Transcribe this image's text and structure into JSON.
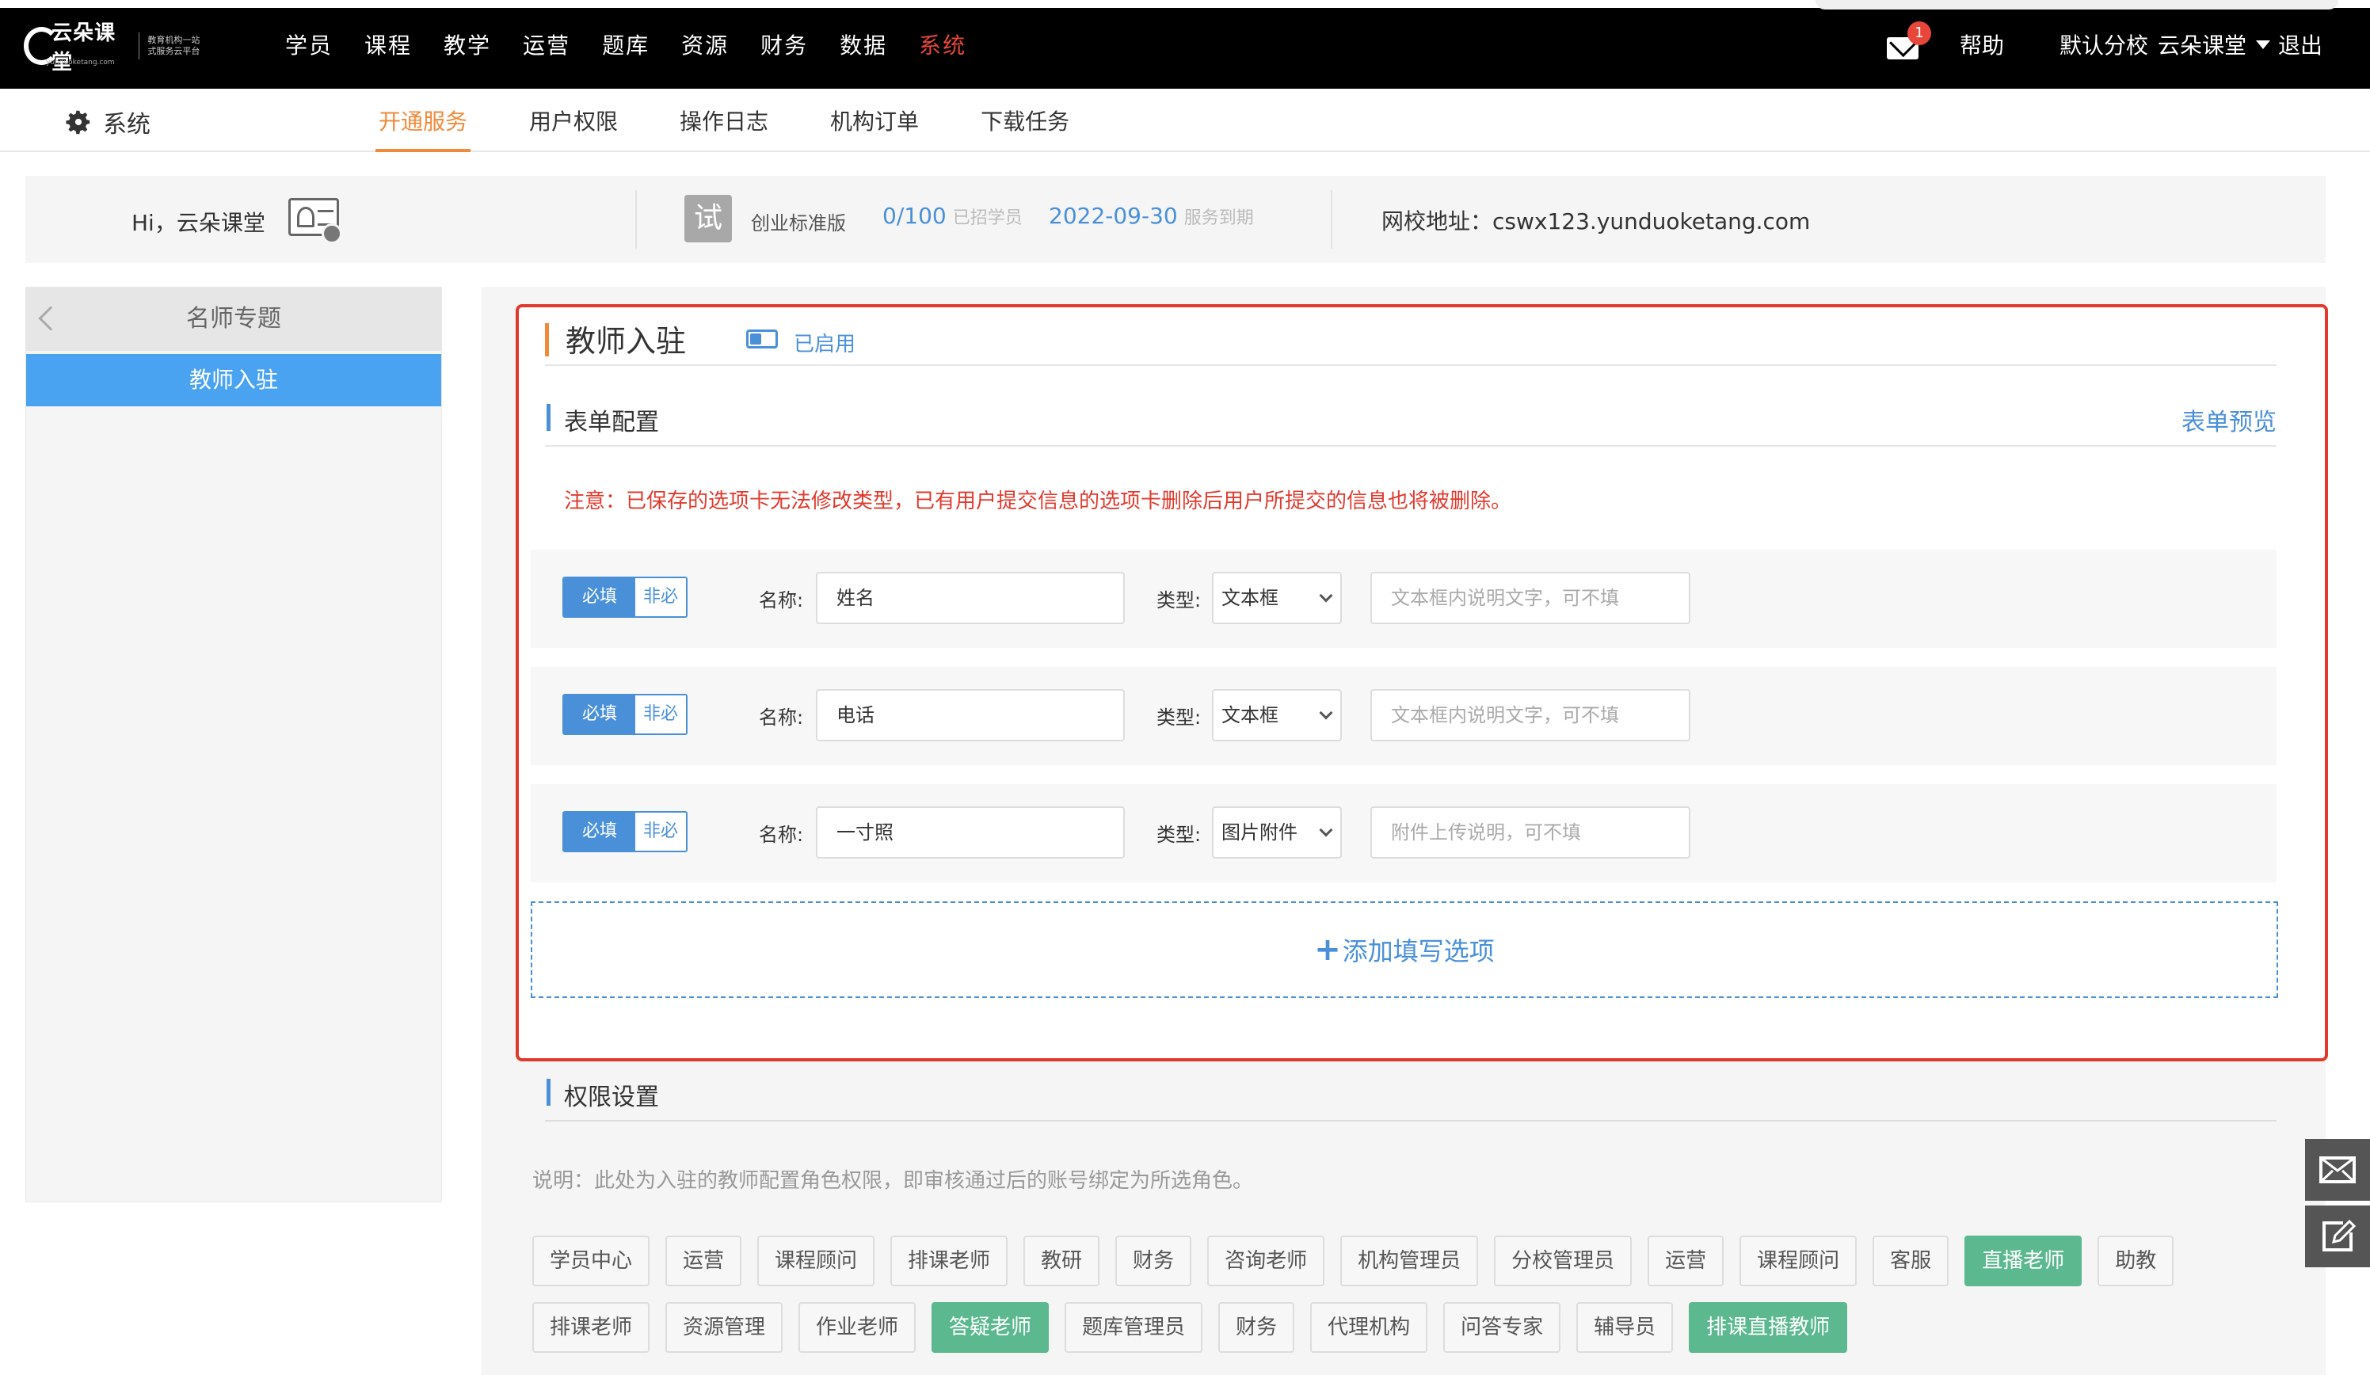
{
  "topbar": {
    "logo": {
      "name": "云朵课堂",
      "slogan": "教育机构一站式服务云平台",
      "domain": "yunduoketang.com"
    },
    "nav": [
      "学员",
      "课程",
      "教学",
      "运营",
      "题库",
      "资源",
      "财务",
      "数据",
      "系统"
    ],
    "active_nav": "系统",
    "mail_badge": "1",
    "help": "帮助",
    "branch": "默认分校",
    "user": "云朵课堂",
    "logout": "退出"
  },
  "subnav": {
    "section": "系统",
    "tabs": [
      "开通服务",
      "用户权限",
      "操作日志",
      "机构订单",
      "下载任务"
    ],
    "active_tab": "开通服务"
  },
  "info": {
    "greeting": "Hi，云朵课堂",
    "trial_badge": "试",
    "edition": "创业标准版",
    "quota": "0/100",
    "quota_label": "已招学员",
    "expire_date": "2022-09-30",
    "expire_label": "服务到期",
    "url_label": "网校地址：",
    "url": "cswx123.yunduoketang.com"
  },
  "sidebar": {
    "title": "名师专题",
    "items": [
      "教师入驻"
    ]
  },
  "main": {
    "title": "教师入驻",
    "status": "已启用",
    "form_section": "表单配置",
    "preview_link": "表单预览",
    "notice": "注意：已保存的选项卡无法修改类型，已有用户提交信息的选项卡删除后用户所提交的信息也将被删除。",
    "required_label": "必填",
    "optional_label": "非必填",
    "name_label": "名称:",
    "type_label": "类型:",
    "fields": [
      {
        "name": "姓名",
        "type": "文本框",
        "hint": "文本框内说明文字，可不填"
      },
      {
        "name": "电话",
        "type": "文本框",
        "hint": "文本框内说明文字，可不填"
      },
      {
        "name": "一寸照",
        "type": "图片附件",
        "hint": "附件上传说明，可不填"
      }
    ],
    "add_option": "添加填写选项",
    "perm_section": "权限设置",
    "perm_note": "说明：此处为入驻的教师配置角色权限，即审核通过后的账号绑定为所选角色。",
    "roles_row1": [
      {
        "label": "学员中心",
        "on": false
      },
      {
        "label": "运营",
        "on": false
      },
      {
        "label": "课程顾问",
        "on": false
      },
      {
        "label": "排课老师",
        "on": false
      },
      {
        "label": "教研",
        "on": false
      },
      {
        "label": "财务",
        "on": false
      },
      {
        "label": "咨询老师",
        "on": false
      },
      {
        "label": "机构管理员",
        "on": false
      },
      {
        "label": "分校管理员",
        "on": false
      },
      {
        "label": "运营",
        "on": false
      },
      {
        "label": "课程顾问",
        "on": false
      },
      {
        "label": "客服",
        "on": false
      },
      {
        "label": "直播老师",
        "on": true
      },
      {
        "label": "助教",
        "on": false
      }
    ],
    "roles_row2": [
      {
        "label": "排课老师",
        "on": false
      },
      {
        "label": "资源管理",
        "on": false
      },
      {
        "label": "作业老师",
        "on": false
      },
      {
        "label": "答疑老师",
        "on": true
      },
      {
        "label": "题库管理员",
        "on": false
      },
      {
        "label": "财务",
        "on": false
      },
      {
        "label": "代理机构",
        "on": false
      },
      {
        "label": "问答专家",
        "on": false
      },
      {
        "label": "辅导员",
        "on": false
      },
      {
        "label": "排课直播教师",
        "on": true
      }
    ]
  },
  "colors": {
    "accent_blue": "#4a90d9",
    "accent_orange": "#f08a3a",
    "alert_red": "#e03a2e",
    "selected_green": "#5bb88f"
  },
  "icons": [
    "mail-icon",
    "gear-icon",
    "id-card-icon",
    "back-chevron-icon",
    "toggle-icon",
    "chevron-down-icon",
    "message-icon",
    "edit-icon"
  ]
}
